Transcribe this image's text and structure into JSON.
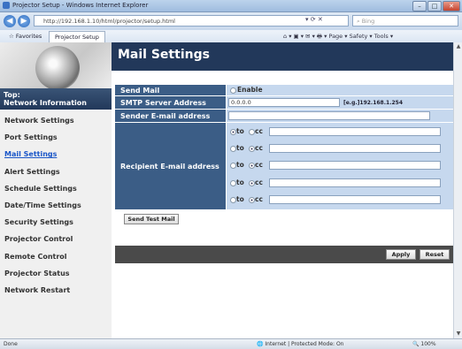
{
  "window": {
    "title": "Projector Setup - Windows Internet Explorer",
    "buttons": [
      "–",
      "□",
      "✕"
    ]
  },
  "browser": {
    "address": "http://192.168.1.10/html/projector/setup.html",
    "search_placeholder": "Bing",
    "favorites_label": "Favorites",
    "tab_label": "Projector Setup",
    "command_bar": "Page ▾  Safety ▾  Tools ▾",
    "status_text": "Done",
    "zone_text": "Internet | Protected Mode: On",
    "zoom_text": "100%"
  },
  "nav": {
    "top_line1": "Top:",
    "top_line2": "Network Information",
    "items": [
      "Network Settings",
      "Port Settings",
      "Mail Settings",
      "Alert Settings",
      "Schedule Settings",
      "Date/Time Settings",
      "Security Settings",
      "Projector Control",
      "Remote Control",
      "Projector Status",
      "Network Restart"
    ],
    "active_index": 2
  },
  "page": {
    "title": "Mail Settings"
  },
  "form": {
    "send_mail_label": "Send Mail",
    "send_mail_option": "Enable",
    "smtp_label": "SMTP Server Address",
    "smtp_value": "0.0.0.0",
    "smtp_hint": "[e.g.]192.168.1.254",
    "sender_label": "Sender E-mail address",
    "sender_value": "",
    "recipient_label": "Recipient E-mail address",
    "to_label": "to",
    "cc_label": "cc",
    "recipients": [
      {
        "mode": "to",
        "value": ""
      },
      {
        "mode": "cc",
        "value": ""
      },
      {
        "mode": "cc",
        "value": ""
      },
      {
        "mode": "cc",
        "value": ""
      },
      {
        "mode": "cc",
        "value": ""
      }
    ],
    "send_test_label": "Send Test Mail",
    "apply_label": "Apply",
    "reset_label": "Reset"
  }
}
